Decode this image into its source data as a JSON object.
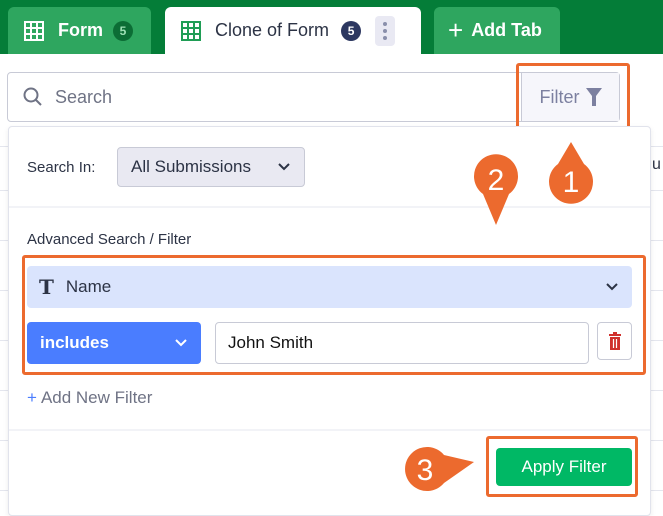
{
  "tabs": [
    {
      "label": "Form",
      "count": "5",
      "icon": "table-icon"
    },
    {
      "label": "Clone of Form",
      "count": "5",
      "icon": "table-icon",
      "active": true
    },
    {
      "label": "Add Tab",
      "icon": "plus-icon"
    }
  ],
  "search": {
    "placeholder": "Search",
    "filter_label": "Filter"
  },
  "panel": {
    "search_in_label": "Search In:",
    "search_in_value": "All Submissions",
    "advanced_label": "Advanced Search / Filter",
    "field_value": "Name",
    "operator_value": "includes",
    "filter_value": "John Smith",
    "add_filter_label": "Add New Filter",
    "apply_label": "Apply Filter"
  },
  "background_text": "u",
  "steps": [
    "1",
    "2",
    "3"
  ],
  "colors": {
    "header_green": "#047d38",
    "tab_green": "#2ea65f",
    "accent_blue": "#4a7dff",
    "apply_green": "#00b865",
    "annotation_orange": "#ec6a2e"
  }
}
